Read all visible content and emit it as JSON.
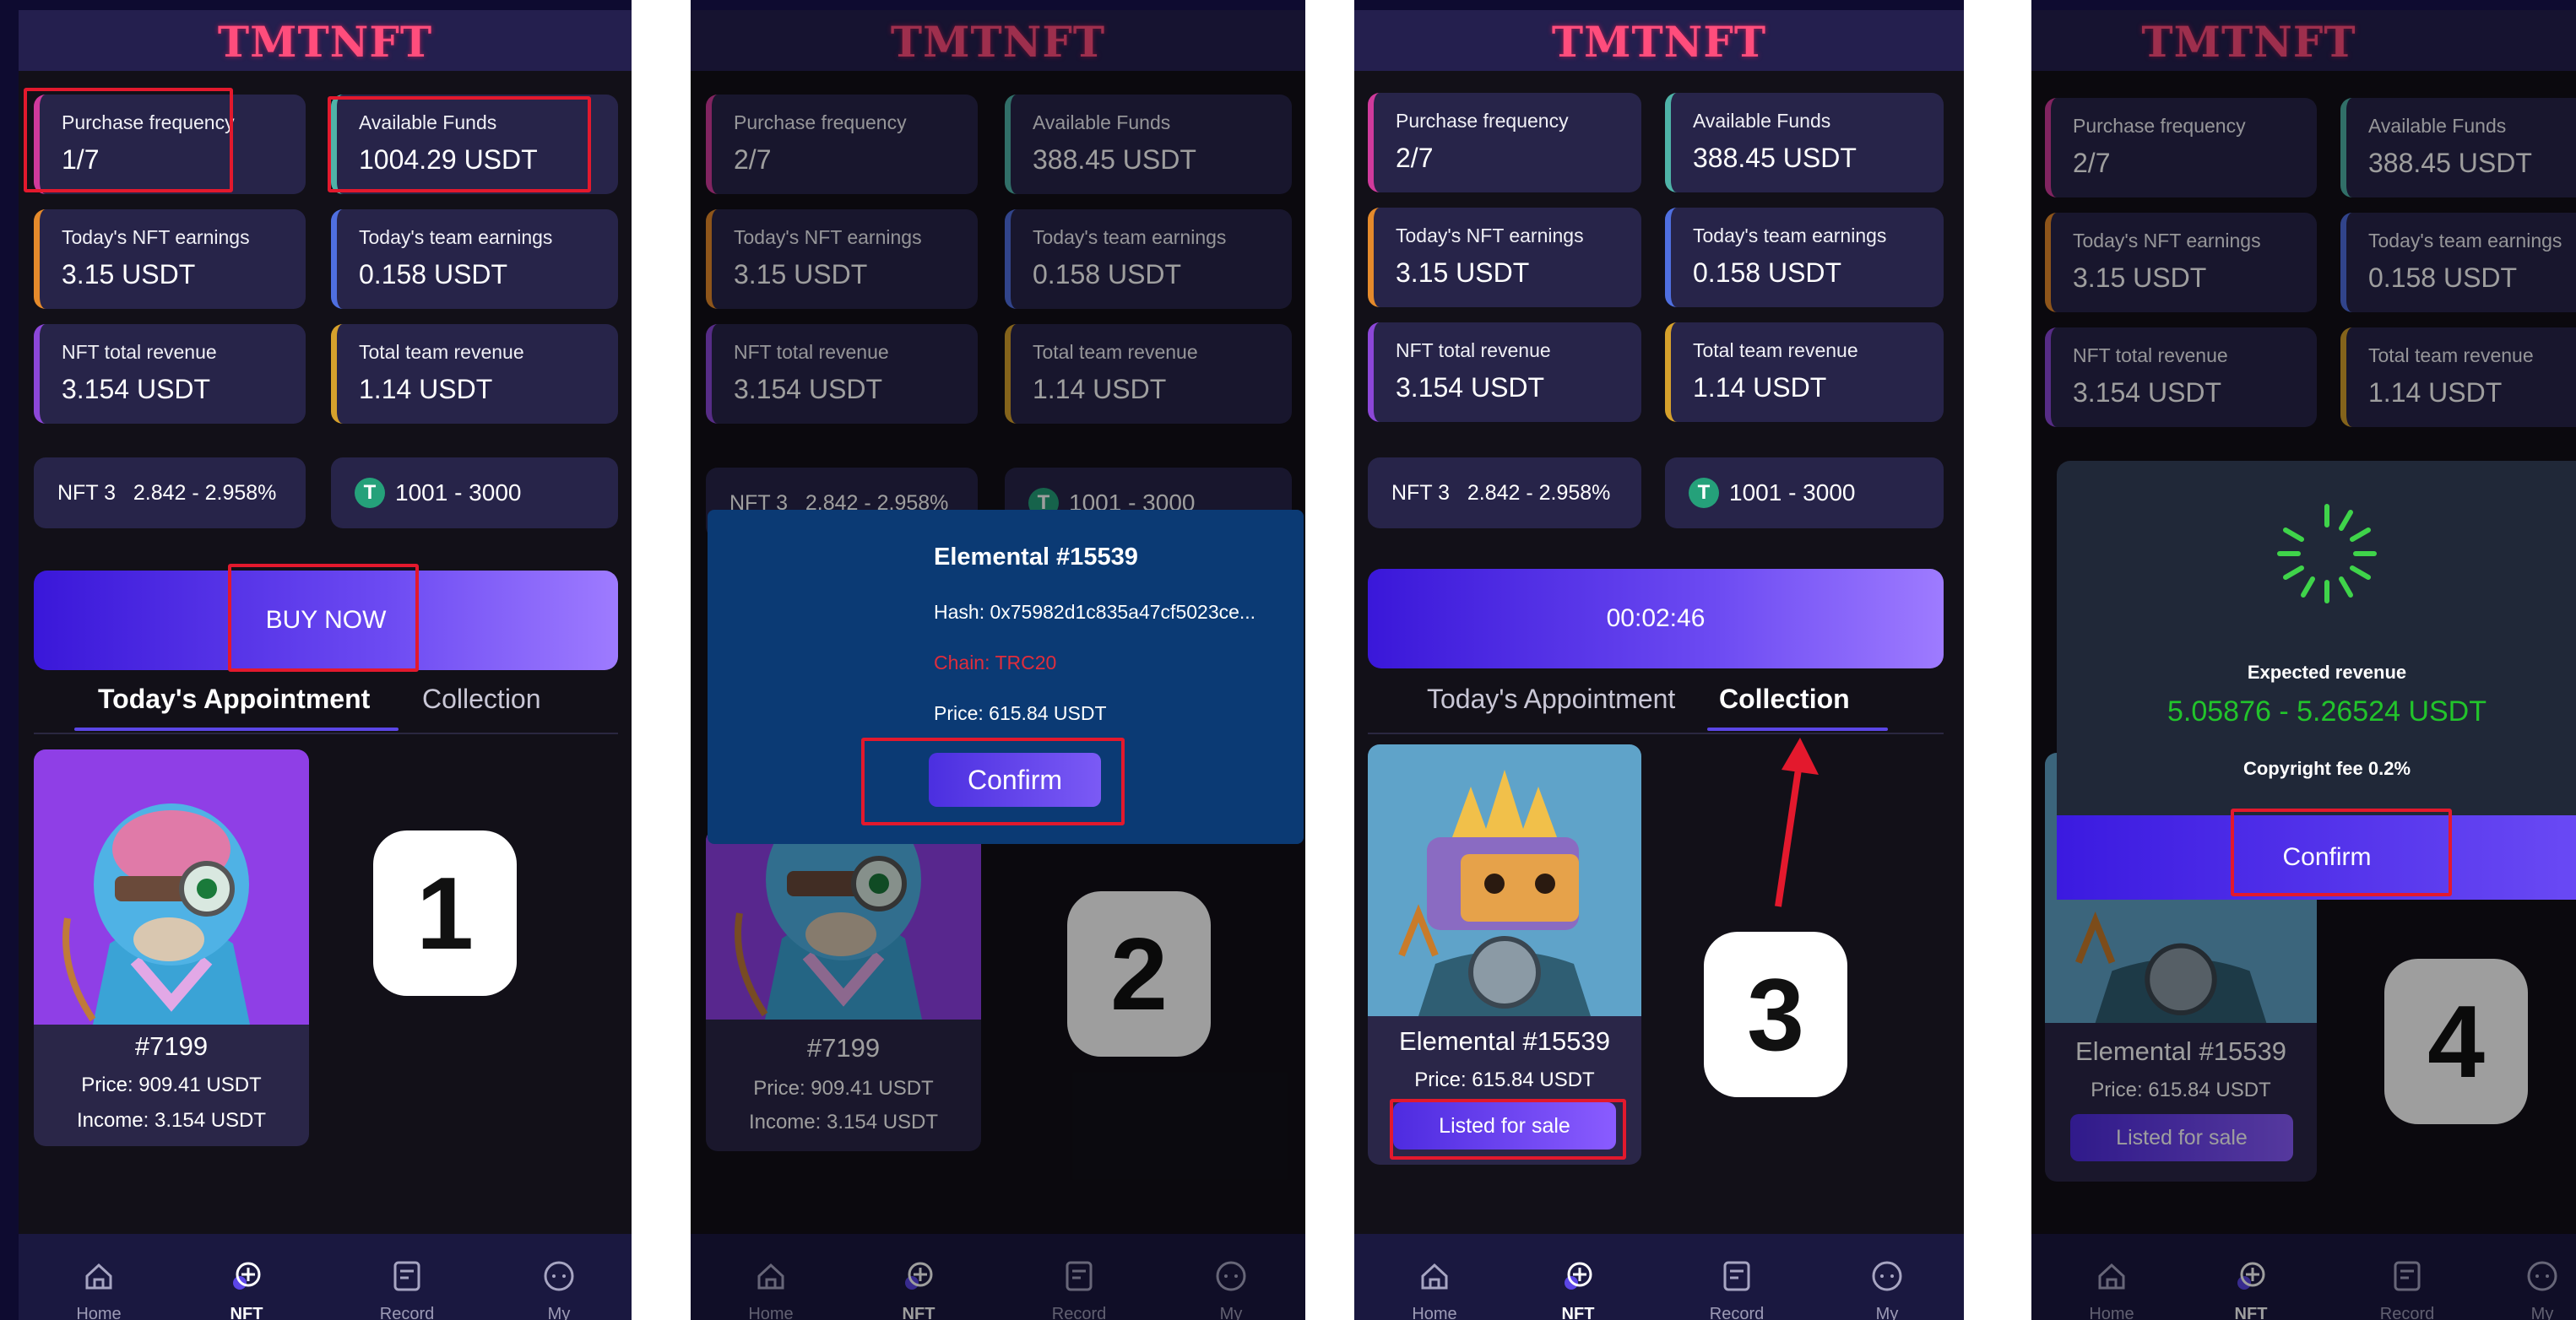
{
  "app": {
    "logo": "TMTNFT"
  },
  "stats_1": {
    "purchase_frequency_label": "Purchase frequency",
    "purchase_frequency_value": "1/7",
    "available_funds_label": "Available Funds",
    "available_funds_value": "1004.29 USDT",
    "todays_nft_earnings_label": "Today's NFT earnings",
    "todays_nft_earnings_value": "3.15 USDT",
    "todays_team_earnings_label": "Today's team earnings",
    "todays_team_earnings_value": "0.158 USDT",
    "nft_total_revenue_label": "NFT total revenue",
    "nft_total_revenue_value": "3.154 USDT",
    "total_team_revenue_label": "Total team revenue",
    "total_team_revenue_value": "1.14 USDT"
  },
  "stats_2": {
    "purchase_frequency_value": "2/7",
    "available_funds_value": "388.45 USDT"
  },
  "level": {
    "nft_level": "NFT 3",
    "rate_range": "2.842 - 2.958%",
    "token_symbol": "T",
    "amount_range": "1001 - 3000"
  },
  "buy_button_label": "BUY NOW",
  "countdown": "00:02:46",
  "tabs": {
    "appointment": "Today's Appointment",
    "collection": "Collection"
  },
  "nft_item_1": {
    "name": "#7199",
    "price": "Price: 909.41 USDT",
    "income": "Income: 3.154 USDT"
  },
  "nft_item_2": {
    "name": "Elemental #15539",
    "price": "Price: 615.84 USDT",
    "status_button": "Listed for sale"
  },
  "confirm_modal": {
    "title": "Elemental #15539",
    "hash": "Hash: 0x75982d1c835a47cf5023ce...",
    "chain": "Chain: TRC20",
    "price": "Price: 615.84 USDT",
    "confirm": "Confirm"
  },
  "revenue_modal": {
    "expected_label": "Expected revenue",
    "expected_value": "5.05876 - 5.26524 USDT",
    "copyright_fee": "Copyright fee 0.2%",
    "confirm": "Confirm"
  },
  "steps": [
    "1",
    "2",
    "3",
    "4"
  ],
  "nav": [
    {
      "label": "Home",
      "icon": "home-icon"
    },
    {
      "label": "NFT",
      "icon": "nft-icon"
    },
    {
      "label": "Record",
      "icon": "record-icon"
    },
    {
      "label": "My",
      "icon": "my-icon"
    }
  ],
  "colors": {
    "background": "#0e0b30",
    "accent": "#5b46e6",
    "highlight": "#e3192d",
    "success": "#22c42b"
  }
}
